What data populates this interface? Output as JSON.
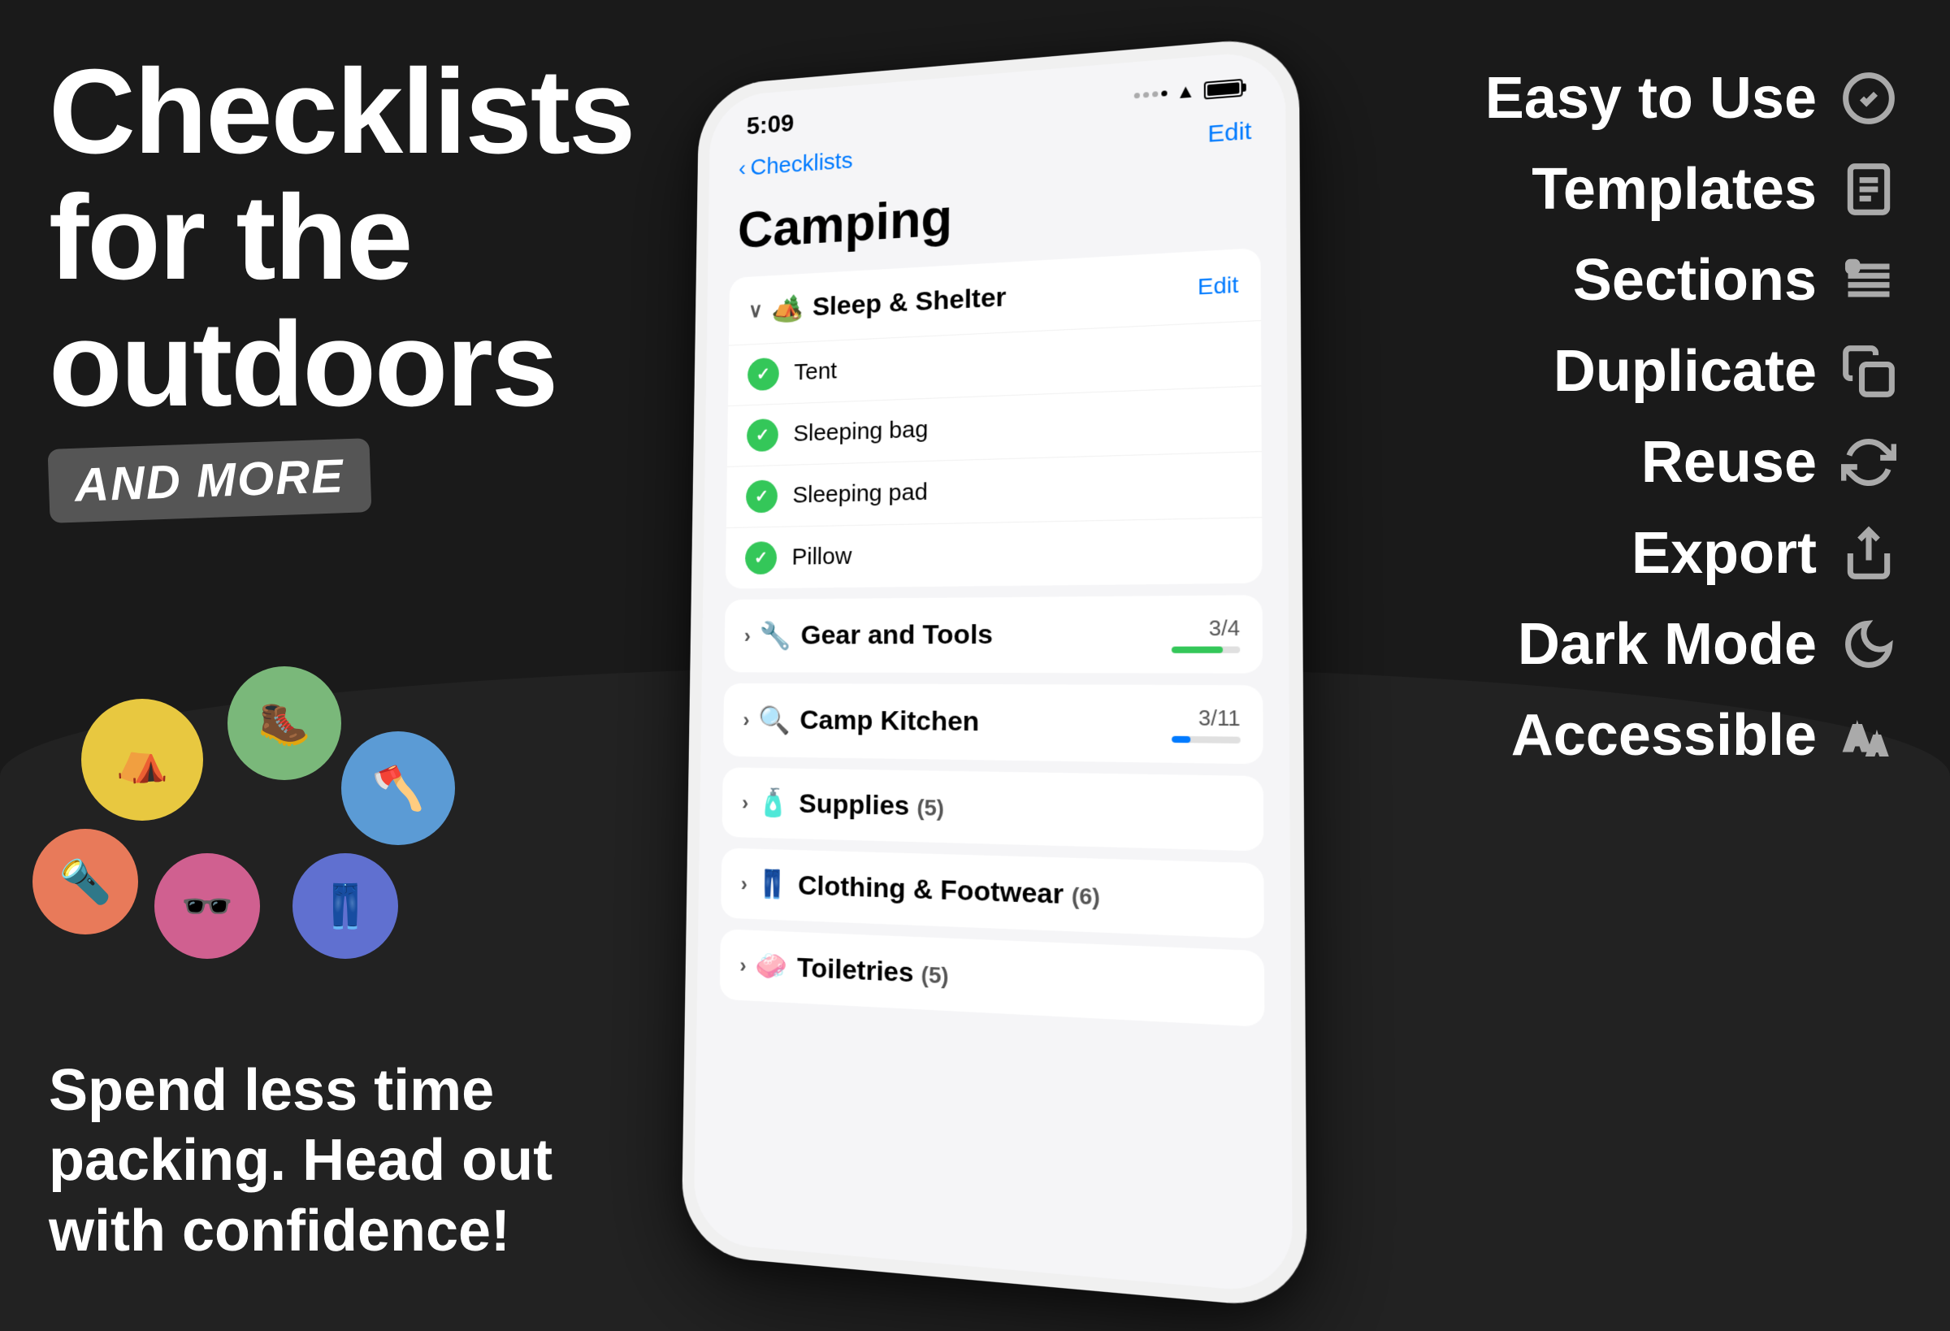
{
  "background": {
    "color": "#1a1a1a"
  },
  "left": {
    "headline_line1": "Checklists",
    "headline_line2": "for the",
    "headline_line3": "outdoors",
    "badge": "and more",
    "tagline_line1": "Spend less time",
    "tagline_line2": "packing. Head out",
    "tagline_line3": "with confidence!"
  },
  "emojis": [
    {
      "symbol": "⛺",
      "bg": "#e8c840"
    },
    {
      "symbol": "🥾",
      "bg": "#7ab87a"
    },
    {
      "symbol": "🪓",
      "bg": "#5b9bd5"
    },
    {
      "symbol": "🔦",
      "bg": "#e87a5a"
    },
    {
      "symbol": "🕶️",
      "bg": "#d06090"
    },
    {
      "symbol": "👖",
      "bg": "#6070d0"
    }
  ],
  "phone": {
    "status_time": "5:09",
    "nav_back": "Checklists",
    "nav_edit": "Edit",
    "title": "Camping",
    "sections": [
      {
        "emoji": "🏕️",
        "title": "Sleep & Shelter",
        "expanded": true,
        "show_edit": true,
        "items": [
          {
            "label": "Tent",
            "checked": true
          },
          {
            "label": "Sleeping bag",
            "checked": true
          },
          {
            "label": "Sleeping pad",
            "checked": true
          },
          {
            "label": "Pillow",
            "checked": true
          }
        ]
      },
      {
        "emoji": "🔧",
        "title": "Gear and Tools",
        "expanded": false,
        "progress": "3/4",
        "progress_pct": 75,
        "progress_color": "green"
      },
      {
        "emoji": "🔍",
        "title": "Camp Kitchen",
        "expanded": false,
        "progress": "3/11",
        "progress_pct": 27,
        "progress_color": "blue"
      },
      {
        "emoji": "🧴",
        "title": "Supplies",
        "count": "(5)",
        "expanded": false
      },
      {
        "emoji": "👖",
        "title": "Clothing & Footwear",
        "count": "(6)",
        "expanded": false
      },
      {
        "emoji": "🧼",
        "title": "Toiletries",
        "count": "(5)",
        "expanded": false
      }
    ]
  },
  "features": [
    {
      "label": "Easy to Use",
      "icon": "check-circle"
    },
    {
      "label": "Templates",
      "icon": "document"
    },
    {
      "label": "Sections",
      "icon": "list"
    },
    {
      "label": "Duplicate",
      "icon": "copy"
    },
    {
      "label": "Reuse",
      "icon": "refresh"
    },
    {
      "label": "Export",
      "icon": "share"
    },
    {
      "label": "Dark Mode",
      "icon": "moon"
    },
    {
      "label": "Accessible",
      "icon": "text-size"
    }
  ]
}
